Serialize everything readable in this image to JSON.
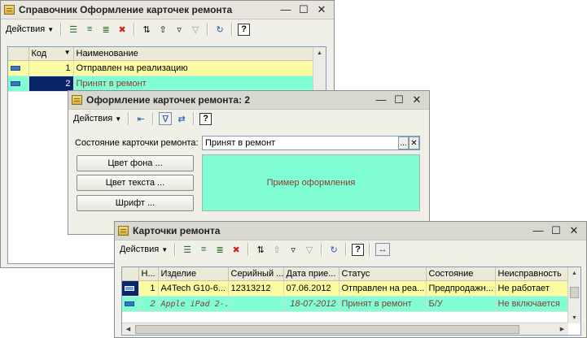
{
  "win1": {
    "title": "Справочник Оформление карточек ремонта",
    "toolbar": {
      "actions_label": "Действия",
      "help_label": "?"
    },
    "columns": [
      "Код",
      "Наименование"
    ],
    "rows": [
      {
        "code": "1",
        "name": "Отправлен на реализацию",
        "bg": "#fbfba2"
      },
      {
        "code": "2",
        "name": "Принят в ремонт",
        "bg": "#80ffd4"
      }
    ]
  },
  "win2": {
    "title": "Оформление карточек ремонта: 2",
    "toolbar": {
      "actions_label": "Действия",
      "help_label": "?"
    },
    "state_label": "Состояние карточки ремонта:",
    "state_value": "Принят в ремонт",
    "bg_color_button": "Цвет фона ...",
    "text_color_button": "Цвет текста ...",
    "font_button": "Шрифт ...",
    "sample_text": "Пример оформления",
    "sample_bg": "#80ffd4",
    "sample_color": "#8b3a2e"
  },
  "win3": {
    "title": "Карточки ремонта",
    "toolbar": {
      "actions_label": "Действия",
      "help_label": "?"
    },
    "columns": [
      "Н...",
      "Изделие",
      "Серийный ...",
      "Дата прие...",
      "Статус",
      "Состояние",
      "Неисправность"
    ],
    "rows": [
      {
        "num": "1",
        "item": "A4Tech G10-6...",
        "serial": "12313212",
        "date": "07.06.2012",
        "status": "Отправлен на реа...",
        "state": "Предпродажн...",
        "fault": "Не работает",
        "bg": "#fbfba2",
        "italic": false,
        "color": "#000000"
      },
      {
        "num": "2",
        "item": "Apple iPad 2-...",
        "serial": "",
        "date": "18-07-2012",
        "status": "Принят в ремонт",
        "state": "Б/У",
        "fault": "Не включается",
        "bg": "#80ffd4",
        "italic": true,
        "color": "#8b3a2e"
      }
    ]
  },
  "colors": {
    "selection": "#0a246a",
    "accent": "#316ac5"
  }
}
